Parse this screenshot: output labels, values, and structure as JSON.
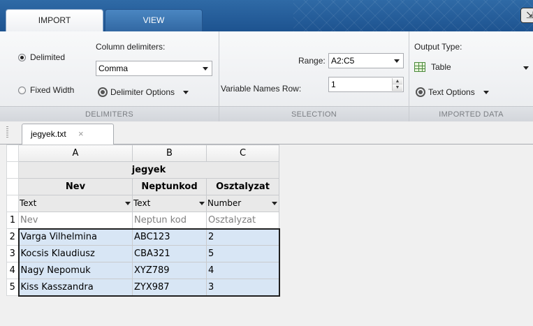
{
  "tabs": [
    {
      "label": "IMPORT",
      "active": true
    },
    {
      "label": "VIEW",
      "active": false
    }
  ],
  "ribbon": {
    "delimiters": {
      "radio_delimited": "Delimited",
      "radio_fixed_width": "Fixed Width",
      "selected": "Delimited",
      "column_delimiters_label": "Column delimiters:",
      "column_delimiters_value": "Comma",
      "delimiter_options_label": "Delimiter Options",
      "section_label": "DELIMITERS"
    },
    "selection": {
      "range_label": "Range:",
      "range_value": "A2:C5",
      "variable_names_row_label": "Variable Names Row:",
      "variable_names_row_value": "1",
      "section_label": "SELECTION"
    },
    "imported_data": {
      "output_type_label": "Output Type:",
      "output_type_value": "Table",
      "text_options_label": "Text Options",
      "section_label": "IMPORTED DATA"
    }
  },
  "document_tab": {
    "label": "jegyek.txt",
    "close": "×"
  },
  "sheet": {
    "column_letters": [
      "A",
      "B",
      "C"
    ],
    "table_name": "jegyek",
    "variable_names": [
      "Nev",
      "Neptunkod",
      "Osztalyzat"
    ],
    "variable_types": [
      "Text",
      "Text",
      "Number"
    ],
    "rows": [
      {
        "num": "1",
        "cells": [
          "Nev",
          "Neptun kod",
          "Osztalyzat"
        ]
      },
      {
        "num": "2",
        "cells": [
          "Varga Vilhelmina",
          "ABC123",
          "2"
        ]
      },
      {
        "num": "3",
        "cells": [
          "Kocsis Klaudiusz",
          "CBA321",
          "5"
        ]
      },
      {
        "num": "4",
        "cells": [
          "Nagy Nepomuk",
          "XYZ789",
          "4"
        ]
      },
      {
        "num": "5",
        "cells": [
          "Kiss Kasszandra",
          "ZYX987",
          "3"
        ]
      }
    ],
    "selected_range": "A2:C5"
  },
  "colors": {
    "tabstrip": "#1d5390",
    "selection_fill": "#d8e6f5",
    "selection_border": "#1f1f1f"
  }
}
